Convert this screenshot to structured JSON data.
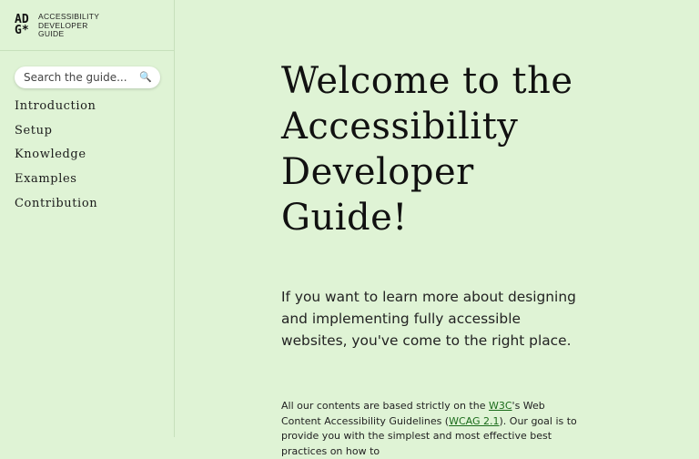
{
  "brand": {
    "logo_line1": "AD",
    "logo_line2": "G*",
    "name_line1": "ACCESSIBILITY",
    "name_line2": "DEVELOPER",
    "name_line3": "GUIDE"
  },
  "search": {
    "placeholder": "Search the guide...",
    "icon": "search-icon"
  },
  "nav": {
    "items": [
      {
        "label": "Introduction"
      },
      {
        "label": "Setup"
      },
      {
        "label": "Knowledge"
      },
      {
        "label": "Examples"
      },
      {
        "label": "Contribution"
      }
    ]
  },
  "main": {
    "title": "Welcome to the Accessibility Developer Guide!",
    "lead": "If you want to learn more about designing and implementing fully accessible websites, you've come to the right place.",
    "body_prefix": "All our contents are based strictly on the ",
    "w3c_link": "W3C",
    "body_mid": "'s Web Content Accessibility Guidelines (",
    "wcag_link": "WCAG 2.1",
    "body_suffix": "). Our goal is to provide you with the simplest and most effective best practices on how to"
  },
  "colors": {
    "background": "#dff3d5",
    "link": "#1a6b1a"
  }
}
